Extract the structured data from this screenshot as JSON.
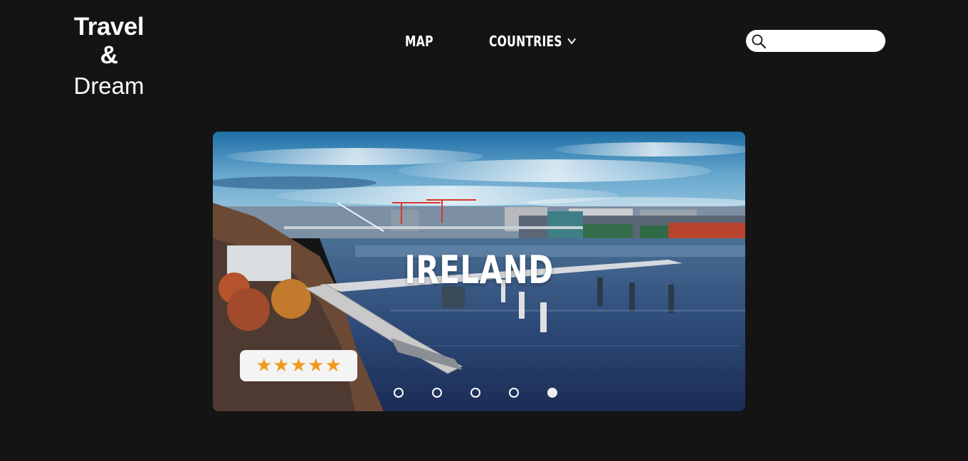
{
  "logo": {
    "line1": "Travel &",
    "line2": "Dream"
  },
  "nav": {
    "map_label": "MAP",
    "countries_label": "COUNTRIES",
    "countries_icon": "chevron-down-icon"
  },
  "search": {
    "placeholder": "",
    "value": "",
    "icon": "search-icon"
  },
  "hero": {
    "title": "IRELAND",
    "rating": {
      "stars": 5,
      "max": 5,
      "star_glyph": "★",
      "star_color": "#f29a1e"
    },
    "slides": {
      "count": 5,
      "active_index": 4
    }
  },
  "colors": {
    "background": "#141414",
    "text": "#ffffff",
    "search_bg": "#ffffff",
    "rating_bg": "#f4f4f4"
  }
}
